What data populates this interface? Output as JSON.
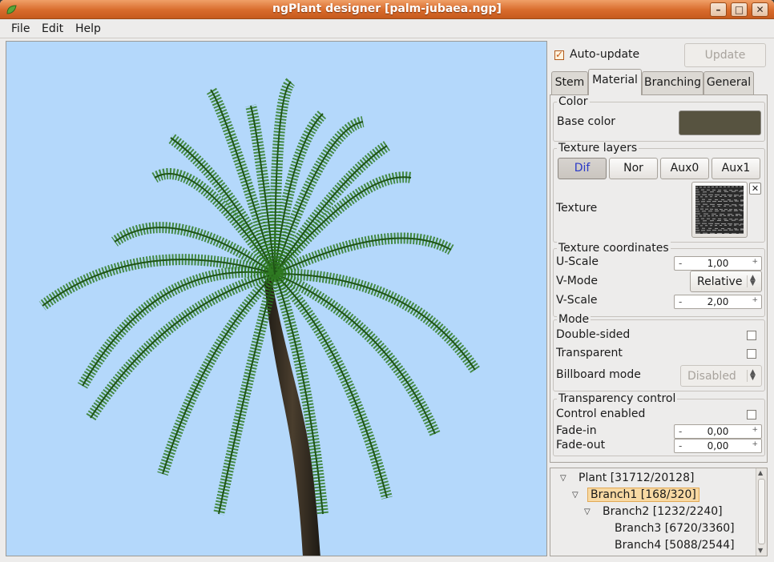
{
  "window": {
    "title": "ngPlant designer [palm-jubaea.ngp]",
    "minimize": "–",
    "maximize": "□",
    "close": "✕"
  },
  "menu": {
    "file": "File",
    "edit": "Edit",
    "help": "Help"
  },
  "toolbar": {
    "auto_update_label": "Auto-update",
    "auto_update_checked": true,
    "update_button": "Update"
  },
  "tabs": [
    "Stem",
    "Material",
    "Branching",
    "General"
  ],
  "selected_tab": "Material",
  "material": {
    "color_group": "Color",
    "base_color_label": "Base color",
    "base_color": "#575340",
    "texture_layers_group": "Texture layers",
    "layer_buttons": [
      "Dif",
      "Nor",
      "Aux0",
      "Aux1"
    ],
    "active_layer": "Dif",
    "texture_label": "Texture",
    "texcoord_group": "Texture coordinates",
    "u_scale_label": "U-Scale",
    "u_scale_value": "1,00",
    "v_mode_label": "V-Mode",
    "v_mode_value": "Relative",
    "v_scale_label": "V-Scale",
    "v_scale_value": "2,00",
    "mode_group": "Mode",
    "double_sided_label": "Double-sided",
    "transparent_label": "Transparent",
    "billboard_label": "Billboard mode",
    "billboard_value": "Disabled",
    "transparency_group": "Transparency control",
    "control_enabled_label": "Control enabled",
    "fade_in_label": "Fade-in",
    "fade_in_value": "0,00",
    "fade_out_label": "Fade-out",
    "fade_out_value": "0,00"
  },
  "tree": {
    "items": [
      {
        "label": "Plant [31712/20128]",
        "level": 0,
        "expanded": true,
        "selected": false
      },
      {
        "label": "Branch1 [168/320]",
        "level": 1,
        "expanded": true,
        "selected": true
      },
      {
        "label": "Branch2 [1232/2240]",
        "level": 2,
        "expanded": true,
        "selected": false
      },
      {
        "label": "Branch3 [6720/3360]",
        "level": 3,
        "expanded": false,
        "selected": false
      },
      {
        "label": "Branch4 [5088/2544]",
        "level": 3,
        "expanded": false,
        "selected": false
      }
    ]
  },
  "colors": {
    "viewport_bg": "#b4d8fb",
    "accent": "#d86b2c",
    "leaf": "#2f7a22",
    "trunk": "#3a3024"
  }
}
